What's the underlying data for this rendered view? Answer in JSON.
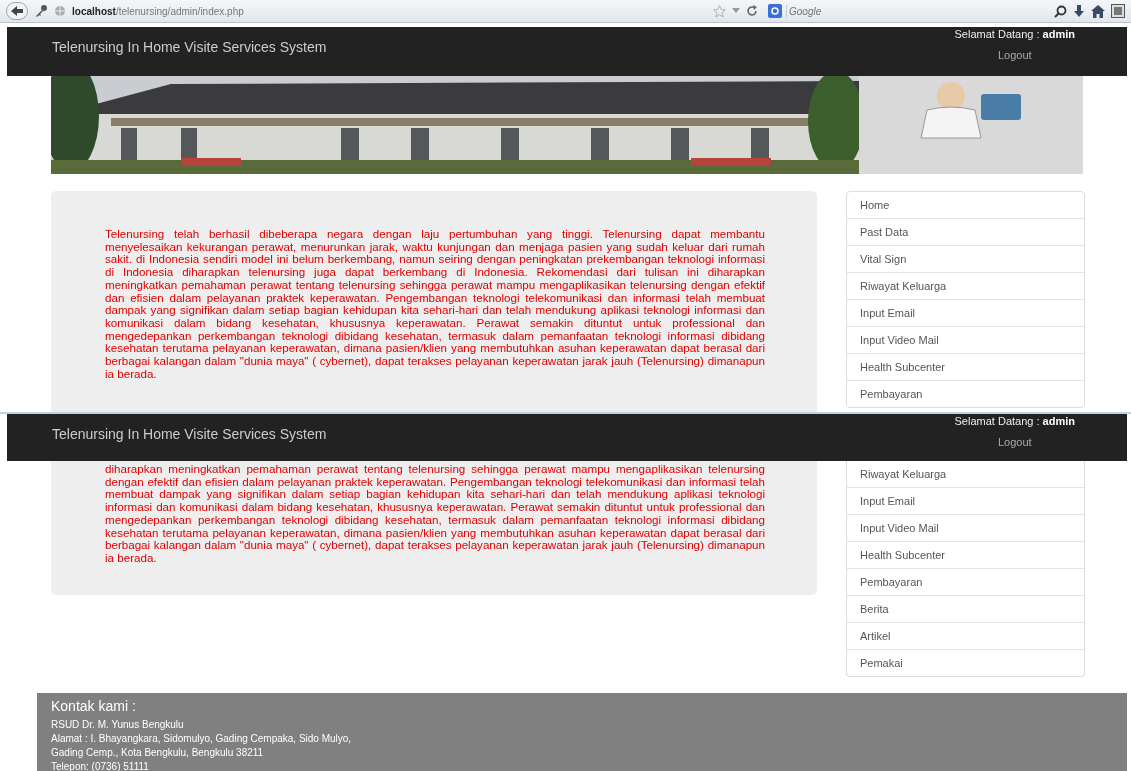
{
  "browser": {
    "url_host": "localhost",
    "url_path": "/telenursing/admin/index.php",
    "search_placeholder": "Google"
  },
  "screens": [
    {
      "navbar": {
        "brand": "Telenursing In Home Visite Services System",
        "greeting": "Selamat Datang : **admin**",
        "logout": "Logout"
      },
      "paragraph": "Telenursing telah berhasil dibeberapa negara dengan laju pertumbuhan yang tinggi. Telenursing dapat membantu menyelesaikan kekurangan perawat, menurunkan jarak, waktu kunjungan dan menjaga pasien yang sudah keluar dari rumah sakit. di Indonesia sendiri model ini belum berkembang, namun seiring dengan peningkatan prekembangan teknologi informasi di Indonesia diharapkan telenursing juga dapat berkembang di Indonesia. Rekomendasi dari tulisan ini diharapkan meningkatkan pemahaman perawat tentang telenursing sehingga perawat mampu mengaplikasikan telenursing dengan efektif dan efisien dalam pelayanan praktek keperawatan. Pengembangan teknologi telekomunikasi dan informasi telah membuat dampak yang signifikan dalam setiap bagian kehidupan kita sehari-hari dan telah mendukung aplikasi teknologi informasi dan komunikasi dalam bidang kesehatan, khususnya keperawatan. Perawat semakin dituntut untuk professional dan mengedepankan perkembangan teknologi dibidang kesehatan, termasuk dalam pemanfaatan teknologi informasi dibidang kesehatan terutama pelayanan keperawatan, dimana pasien/klien yang membutuhkan asuhan keperawatan dapat berasal dari berbagai kalangan dalam \"dunia maya\" ( cybernet), dapat terakses pelayanan keperawatan jarak jauh (Telenursing) dimanapun ia berada.",
      "menu": [
        "Home",
        "Past Data",
        "Vital Sign",
        "Riwayat Keluarga",
        "Input Email",
        "Input Video Mail",
        "Health Subcenter",
        "Pembayaran"
      ]
    },
    {
      "navbar": {
        "brand": "Telenursing In Home Visite Services System",
        "greeting": "Selamat Datang : **admin**",
        "logout": "Logout"
      },
      "paragraph": "diharapkan meningkatkan pemahaman perawat tentang telenursing sehingga perawat mampu mengaplikasikan telenursing dengan efektif dan efisien dalam pelayanan praktek keperawatan. Pengembangan teknologi telekomunikasi dan informasi telah membuat dampak yang signifikan dalam setiap bagian kehidupan kita sehari-hari dan telah mendukung aplikasi teknologi informasi dan komunikasi dalam bidang kesehatan, khususnya keperawatan. Perawat semakin dituntut untuk professional dan mengedepankan perkembangan teknologi dibidang kesehatan, termasuk dalam pemanfaatan teknologi informasi dibidang kesehatan terutama pelayanan keperawatan, dimana pasien/klien yang membutuhkan asuhan keperawatan dapat berasal dari berbagai kalangan dalam \"dunia maya\" ( cybernet), dapat terakses pelayanan keperawatan jarak jauh (Telenursing) dimanapun ia berada.",
      "menu": [
        "Riwayat Keluarga",
        "Input Email",
        "Input Video Mail",
        "Health Subcenter",
        "Pembayaran",
        "Berita",
        "Artikel",
        "Pemakai"
      ],
      "footer": {
        "title": "Kontak kami :",
        "lines": [
          "RSUD Dr. M. Yunus Bengkulu",
          "Alamat : I. Bhayangkara, Sidomulyo, Gading Cempaka, Sido Mulyo, Gading Cemp., Kota Bengkulu, Bengkulu 38211",
          "Telepon: (0736) 51111"
        ]
      }
    }
  ]
}
